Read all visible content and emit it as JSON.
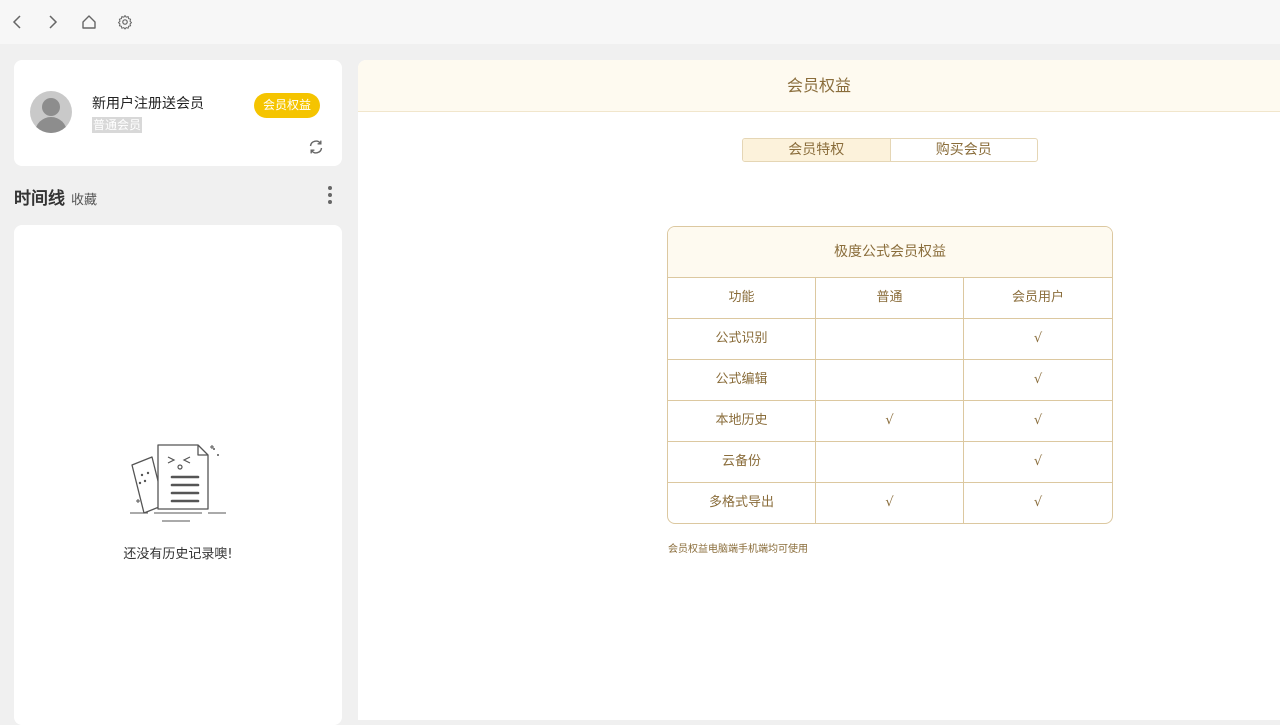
{
  "toolbar": {
    "icons": [
      "back-icon",
      "forward-icon",
      "home-icon",
      "settings-icon"
    ]
  },
  "user": {
    "name": "新用户注册送会员",
    "level": "普通会员",
    "badge": "会员权益"
  },
  "timeline": {
    "title": "时间线",
    "favorites": "收藏"
  },
  "history": {
    "empty_text": "还没有历史记录噢!"
  },
  "main": {
    "title": "会员权益",
    "tabs": [
      {
        "label": "会员特权",
        "active": true
      },
      {
        "label": "购买会员",
        "active": false
      }
    ],
    "table": {
      "title": "极度公式会员权益",
      "headers": [
        "功能",
        "普通",
        "会员用户"
      ],
      "rows": [
        [
          "公式识别",
          "",
          "√"
        ],
        [
          "公式编辑",
          "",
          "√"
        ],
        [
          "本地历史",
          "√",
          "√"
        ],
        [
          "云备份",
          "",
          "√"
        ],
        [
          "多格式导出",
          "√",
          "√"
        ]
      ]
    },
    "note": "会员权益电脑端手机端均可使用"
  },
  "colors": {
    "accent": "#f5c400",
    "gold_text": "#8a6d3b",
    "border": "#dcc8a0",
    "header_bg": "#fefaf0"
  }
}
